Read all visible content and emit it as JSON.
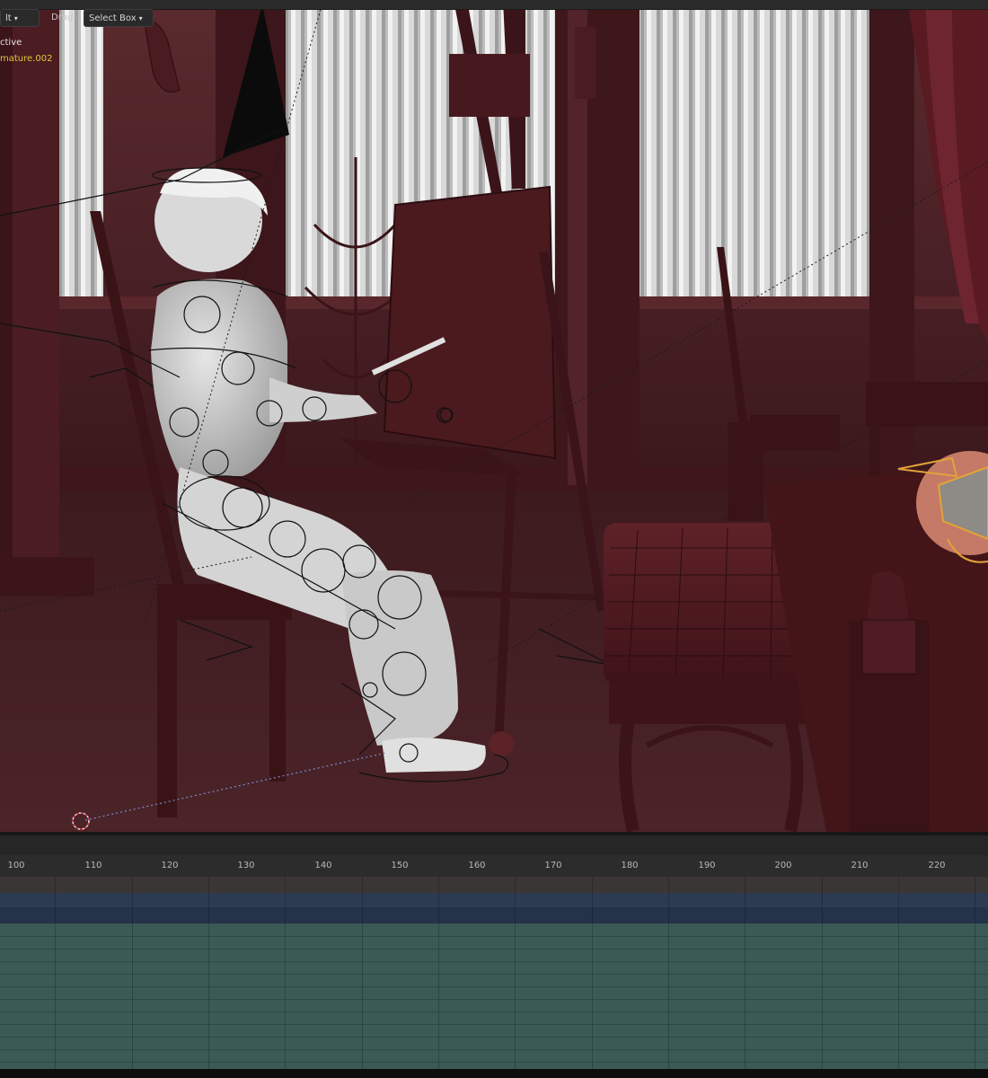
{
  "header": {
    "mode_label_fragment": "lt",
    "drag_label": "Drag:",
    "select_box_label": "Select Box"
  },
  "overlay": {
    "active_fragment": "ctive",
    "armature_fragment": "mature.002"
  },
  "timeline": {
    "frame_ticks": [
      "100",
      "110",
      "120",
      "130",
      "140",
      "150",
      "160",
      "170",
      "180",
      "190",
      "200",
      "210",
      "220"
    ]
  },
  "colors": {
    "viewport_bg": "#4d2225",
    "wood": "#3a1216",
    "curtain": "#dcdcdc",
    "figure": "#cfcfcf",
    "armature_accent": "#e2c73a",
    "timeline_blue": "#2d3b52",
    "timeline_green": "#3b5a55"
  },
  "icons": {
    "camera": "camera-icon",
    "cursor": "3d-cursor-icon"
  }
}
